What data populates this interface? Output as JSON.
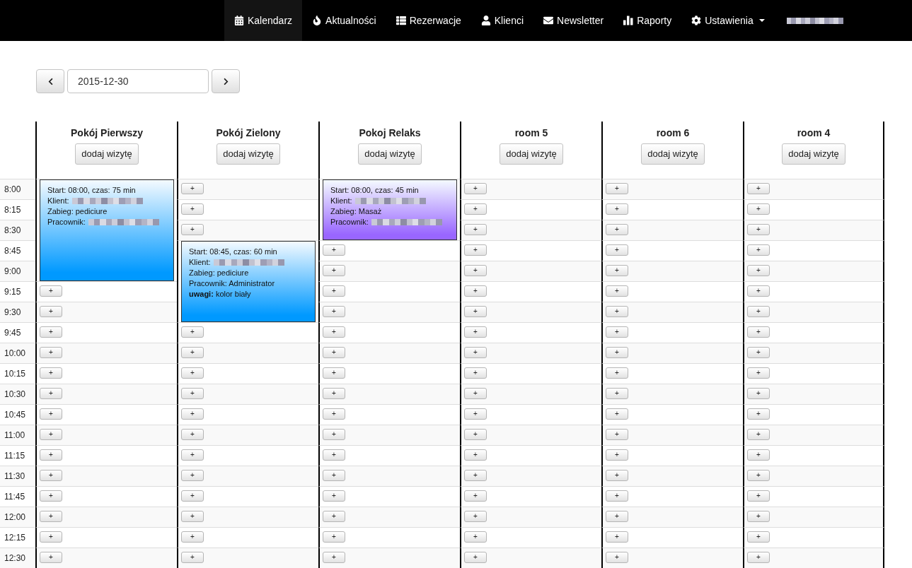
{
  "nav": {
    "items": [
      {
        "label": "Kalendarz",
        "selected": true,
        "dropdown": false
      },
      {
        "label": "Aktualności",
        "selected": false,
        "dropdown": false
      },
      {
        "label": "Rezerwacje",
        "selected": false,
        "dropdown": false
      },
      {
        "label": "Klienci",
        "selected": false,
        "dropdown": false
      },
      {
        "label": "Newsletter",
        "selected": false,
        "dropdown": false
      },
      {
        "label": "Raporty",
        "selected": false,
        "dropdown": false
      },
      {
        "label": "Ustawienia",
        "selected": false,
        "dropdown": true
      }
    ],
    "account_redacted": true
  },
  "date_picker": {
    "value": "2015-12-30"
  },
  "calendar": {
    "rooms": [
      {
        "name": "Pokój Pierwszy",
        "add_button": "dodaj wizytę"
      },
      {
        "name": "Pokój Zielony",
        "add_button": "dodaj wizytę"
      },
      {
        "name": "Pokoj Relaks",
        "add_button": "dodaj wizytę"
      },
      {
        "name": "room 5",
        "add_button": "dodaj wizytę"
      },
      {
        "name": "room 6",
        "add_button": "dodaj wizytę"
      },
      {
        "name": "room 4",
        "add_button": "dodaj wizytę"
      }
    ],
    "rows": [
      {
        "time": "8:00",
        "cells": [
          {
            "kind": "appointment",
            "color": "#0099ff",
            "lines": [
              {
                "text": "Start: 08:00, czas: 75 min",
                "redacted": false
              },
              {
                "text": "Klient:",
                "redacted": true
              },
              {
                "text": "Zabieg: pediciure",
                "redacted": false
              },
              {
                "text": "Pracownik:",
                "redacted": true
              }
            ]
          },
          {
            "kind": "add",
            "label": "+"
          },
          {
            "kind": "appointment",
            "color": "#9966ff",
            "lines": [
              {
                "text": "Start: 08:00, czas: 45 min",
                "redacted": false
              },
              {
                "text": "Klient:",
                "redacted": true
              },
              {
                "text": "Zabieg: Masaż",
                "redacted": false
              },
              {
                "text": "Pracownik:",
                "redacted": true
              }
            ]
          },
          {
            "kind": "add",
            "label": "+"
          },
          {
            "kind": "add",
            "label": "+"
          },
          {
            "kind": "add",
            "label": "+"
          }
        ]
      },
      {
        "time": "8:15",
        "cells": [
          {
            "kind": "continued"
          },
          {
            "kind": "add",
            "label": "+"
          },
          {
            "kind": "continued"
          },
          {
            "kind": "add",
            "label": "+"
          },
          {
            "kind": "add",
            "label": "+"
          },
          {
            "kind": "add",
            "label": "+"
          }
        ]
      },
      {
        "time": "8:30",
        "cells": [
          {
            "kind": "continued"
          },
          {
            "kind": "add",
            "label": "+"
          },
          {
            "kind": "continued"
          },
          {
            "kind": "add",
            "label": "+"
          },
          {
            "kind": "add",
            "label": "+"
          },
          {
            "kind": "add",
            "label": "+"
          }
        ]
      },
      {
        "time": "8:45",
        "cells": [
          {
            "kind": "continued"
          },
          {
            "kind": "appointment",
            "color": "#0099ff",
            "lines": [
              {
                "text": "Start: 08:45, czas: 60 min",
                "redacted": false
              },
              {
                "text": "Klient:",
                "redacted": true
              },
              {
                "text": "Zabieg: pediciure",
                "redacted": false
              },
              {
                "text": "Pracownik: Administrator",
                "redacted": false
              },
              {
                "text": "**uwagi:** kolor biały",
                "redacted": false
              }
            ]
          },
          {
            "kind": "add",
            "label": "+"
          },
          {
            "kind": "add",
            "label": "+"
          },
          {
            "kind": "add",
            "label": "+"
          },
          {
            "kind": "add",
            "label": "+"
          }
        ]
      },
      {
        "time": "9:00",
        "cells": [
          {
            "kind": "continued"
          },
          {
            "kind": "continued"
          },
          {
            "kind": "add",
            "label": "+"
          },
          {
            "kind": "add",
            "label": "+"
          },
          {
            "kind": "add",
            "label": "+"
          },
          {
            "kind": "add",
            "label": "+"
          }
        ]
      },
      {
        "time": "9:15",
        "cells": [
          {
            "kind": "add",
            "label": "+"
          },
          {
            "kind": "continued"
          },
          {
            "kind": "add",
            "label": "+"
          },
          {
            "kind": "add",
            "label": "+"
          },
          {
            "kind": "add",
            "label": "+"
          },
          {
            "kind": "add",
            "label": "+"
          }
        ]
      },
      {
        "time": "9:30",
        "cells": [
          {
            "kind": "add",
            "label": "+"
          },
          {
            "kind": "continued"
          },
          {
            "kind": "add",
            "label": "+"
          },
          {
            "kind": "add",
            "label": "+"
          },
          {
            "kind": "add",
            "label": "+"
          },
          {
            "kind": "add",
            "label": "+"
          }
        ]
      },
      {
        "time": "9:45",
        "cells": [
          {
            "kind": "add",
            "label": "+"
          },
          {
            "kind": "add",
            "label": "+"
          },
          {
            "kind": "add",
            "label": "+"
          },
          {
            "kind": "add",
            "label": "+"
          },
          {
            "kind": "add",
            "label": "+"
          },
          {
            "kind": "add",
            "label": "+"
          }
        ]
      },
      {
        "time": "10:00",
        "cells": [
          {
            "kind": "add",
            "label": "+"
          },
          {
            "kind": "add",
            "label": "+"
          },
          {
            "kind": "add",
            "label": "+"
          },
          {
            "kind": "add",
            "label": "+"
          },
          {
            "kind": "add",
            "label": "+"
          },
          {
            "kind": "add",
            "label": "+"
          }
        ]
      },
      {
        "time": "10:15",
        "cells": [
          {
            "kind": "add",
            "label": "+"
          },
          {
            "kind": "add",
            "label": "+"
          },
          {
            "kind": "add",
            "label": "+"
          },
          {
            "kind": "add",
            "label": "+"
          },
          {
            "kind": "add",
            "label": "+"
          },
          {
            "kind": "add",
            "label": "+"
          }
        ]
      },
      {
        "time": "10:30",
        "cells": [
          {
            "kind": "add",
            "label": "+"
          },
          {
            "kind": "add",
            "label": "+"
          },
          {
            "kind": "add",
            "label": "+"
          },
          {
            "kind": "add",
            "label": "+"
          },
          {
            "kind": "add",
            "label": "+"
          },
          {
            "kind": "add",
            "label": "+"
          }
        ]
      },
      {
        "time": "10:45",
        "cells": [
          {
            "kind": "add",
            "label": "+"
          },
          {
            "kind": "add",
            "label": "+"
          },
          {
            "kind": "add",
            "label": "+"
          },
          {
            "kind": "add",
            "label": "+"
          },
          {
            "kind": "add",
            "label": "+"
          },
          {
            "kind": "add",
            "label": "+"
          }
        ]
      },
      {
        "time": "11:00",
        "cells": [
          {
            "kind": "add",
            "label": "+"
          },
          {
            "kind": "add",
            "label": "+"
          },
          {
            "kind": "add",
            "label": "+"
          },
          {
            "kind": "add",
            "label": "+"
          },
          {
            "kind": "add",
            "label": "+"
          },
          {
            "kind": "add",
            "label": "+"
          }
        ]
      },
      {
        "time": "11:15",
        "cells": [
          {
            "kind": "add",
            "label": "+"
          },
          {
            "kind": "add",
            "label": "+"
          },
          {
            "kind": "add",
            "label": "+"
          },
          {
            "kind": "add",
            "label": "+"
          },
          {
            "kind": "add",
            "label": "+"
          },
          {
            "kind": "add",
            "label": "+"
          }
        ]
      },
      {
        "time": "11:30",
        "cells": [
          {
            "kind": "add",
            "label": "+"
          },
          {
            "kind": "add",
            "label": "+"
          },
          {
            "kind": "add",
            "label": "+"
          },
          {
            "kind": "add",
            "label": "+"
          },
          {
            "kind": "add",
            "label": "+"
          },
          {
            "kind": "add",
            "label": "+"
          }
        ]
      },
      {
        "time": "11:45",
        "cells": [
          {
            "kind": "add",
            "label": "+"
          },
          {
            "kind": "add",
            "label": "+"
          },
          {
            "kind": "add",
            "label": "+"
          },
          {
            "kind": "add",
            "label": "+"
          },
          {
            "kind": "add",
            "label": "+"
          },
          {
            "kind": "add",
            "label": "+"
          }
        ]
      },
      {
        "time": "12:00",
        "cells": [
          {
            "kind": "add",
            "label": "+"
          },
          {
            "kind": "add",
            "label": "+"
          },
          {
            "kind": "add",
            "label": "+"
          },
          {
            "kind": "add",
            "label": "+"
          },
          {
            "kind": "add",
            "label": "+"
          },
          {
            "kind": "add",
            "label": "+"
          }
        ]
      },
      {
        "time": "12:15",
        "cells": [
          {
            "kind": "add",
            "label": "+"
          },
          {
            "kind": "add",
            "label": "+"
          },
          {
            "kind": "add",
            "label": "+"
          },
          {
            "kind": "add",
            "label": "+"
          },
          {
            "kind": "add",
            "label": "+"
          },
          {
            "kind": "add",
            "label": "+"
          }
        ]
      },
      {
        "time": "12:30",
        "cells": [
          {
            "kind": "add",
            "label": "+"
          },
          {
            "kind": "add",
            "label": "+"
          },
          {
            "kind": "add",
            "label": "+"
          },
          {
            "kind": "add",
            "label": "+"
          },
          {
            "kind": "add",
            "label": "+"
          },
          {
            "kind": "add",
            "label": "+"
          }
        ]
      }
    ]
  }
}
